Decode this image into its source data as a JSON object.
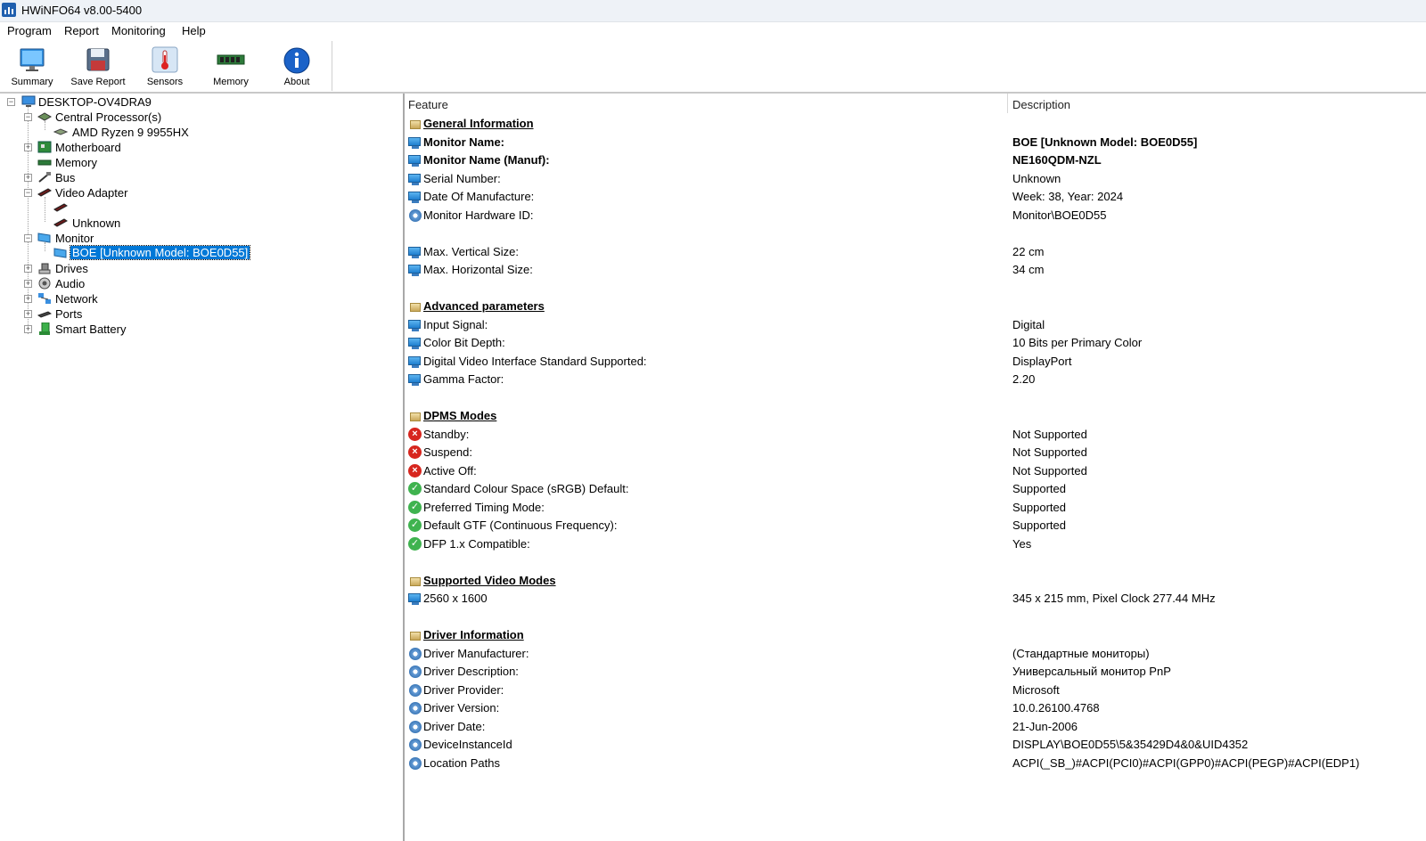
{
  "window": {
    "title": "HWiNFO64 v8.00-5400"
  },
  "menu": [
    "Program",
    "Report",
    "Monitoring",
    "Help"
  ],
  "toolbar": {
    "summary": "Summary",
    "save_report": "Save Report",
    "sensors": "Sensors",
    "memory": "Memory",
    "about": "About"
  },
  "tree": {
    "root": "DESKTOP-OV4DRA9",
    "cpu": "Central Processor(s)",
    "cpu_child": "AMD Ryzen 9 9955HX",
    "motherboard": "Motherboard",
    "memory": "Memory",
    "bus": "Bus",
    "video": "Video Adapter",
    "video_child2": "Unknown",
    "monitor": "Monitor",
    "monitor_child": "BOE [Unknown Model: BOE0D55]",
    "drives": "Drives",
    "audio": "Audio",
    "network": "Network",
    "ports": "Ports",
    "battery": "Smart Battery"
  },
  "details": {
    "col_feature": "Feature",
    "col_description": "Description",
    "rows": [
      {
        "icon": "section",
        "feature": "General Information",
        "value": "",
        "style": "section"
      },
      {
        "icon": "monitor",
        "feature": "Monitor Name:",
        "value": "BOE [Unknown Model: BOE0D55]",
        "style": "bold"
      },
      {
        "icon": "monitor",
        "feature": "Monitor Name (Manuf):",
        "value": "NE160QDM-NZL",
        "style": "bold"
      },
      {
        "icon": "monitor",
        "feature": "Serial Number:",
        "value": "Unknown"
      },
      {
        "icon": "monitor",
        "feature": "Date Of Manufacture:",
        "value": "Week: 38, Year: 2024"
      },
      {
        "icon": "gear",
        "feature": "Monitor Hardware ID:",
        "value": "Monitor\\BOE0D55"
      },
      {
        "icon": "none",
        "feature": "",
        "value": ""
      },
      {
        "icon": "monitor",
        "feature": "Max. Vertical Size:",
        "value": "22 cm"
      },
      {
        "icon": "monitor",
        "feature": "Max. Horizontal Size:",
        "value": "34 cm"
      },
      {
        "icon": "none",
        "feature": "",
        "value": ""
      },
      {
        "icon": "section",
        "feature": "Advanced parameters",
        "value": "",
        "style": "section"
      },
      {
        "icon": "monitor",
        "feature": "Input Signal:",
        "value": "Digital"
      },
      {
        "icon": "monitor",
        "feature": "Color Bit Depth:",
        "value": "10 Bits per Primary Color"
      },
      {
        "icon": "monitor",
        "feature": "Digital Video Interface Standard Supported:",
        "value": "DisplayPort"
      },
      {
        "icon": "monitor",
        "feature": "Gamma Factor:",
        "value": "2.20"
      },
      {
        "icon": "none",
        "feature": "",
        "value": ""
      },
      {
        "icon": "section",
        "feature": "DPMS Modes",
        "value": "",
        "style": "section"
      },
      {
        "icon": "error",
        "feature": "Standby:",
        "value": "Not Supported"
      },
      {
        "icon": "error",
        "feature": "Suspend:",
        "value": "Not Supported"
      },
      {
        "icon": "error",
        "feature": "Active Off:",
        "value": "Not Supported"
      },
      {
        "icon": "check",
        "feature": "Standard Colour Space (sRGB) Default:",
        "value": "Supported"
      },
      {
        "icon": "check",
        "feature": "Preferred Timing Mode:",
        "value": "Supported"
      },
      {
        "icon": "check",
        "feature": "Default GTF (Continuous Frequency):",
        "value": "Supported"
      },
      {
        "icon": "check",
        "feature": "DFP 1.x Compatible:",
        "value": "Yes"
      },
      {
        "icon": "none",
        "feature": "",
        "value": ""
      },
      {
        "icon": "section",
        "feature": "Supported Video Modes",
        "value": "",
        "style": "section"
      },
      {
        "icon": "monitor",
        "feature": "2560 x 1600",
        "value": "345 x 215 mm, Pixel Clock 277.44 MHz"
      },
      {
        "icon": "none",
        "feature": "",
        "value": ""
      },
      {
        "icon": "section",
        "feature": "Driver Information",
        "value": "",
        "style": "section"
      },
      {
        "icon": "gear",
        "feature": "Driver Manufacturer:",
        "value": "(Стандартные мониторы)"
      },
      {
        "icon": "gear",
        "feature": "Driver Description:",
        "value": "Универсальный монитор PnP"
      },
      {
        "icon": "gear",
        "feature": "Driver Provider:",
        "value": "Microsoft"
      },
      {
        "icon": "gear",
        "feature": "Driver Version:",
        "value": "10.0.26100.4768"
      },
      {
        "icon": "gear",
        "feature": "Driver Date:",
        "value": "21-Jun-2006"
      },
      {
        "icon": "gear",
        "feature": "DeviceInstanceId",
        "value": "DISPLAY\\BOE0D55\\5&35429D4&0&UID4352"
      },
      {
        "icon": "gear",
        "feature": "Location Paths",
        "value": "ACPI(_SB_)#ACPI(PCI0)#ACPI(GPP0)#ACPI(PEGP)#ACPI(EDP1)"
      }
    ]
  }
}
